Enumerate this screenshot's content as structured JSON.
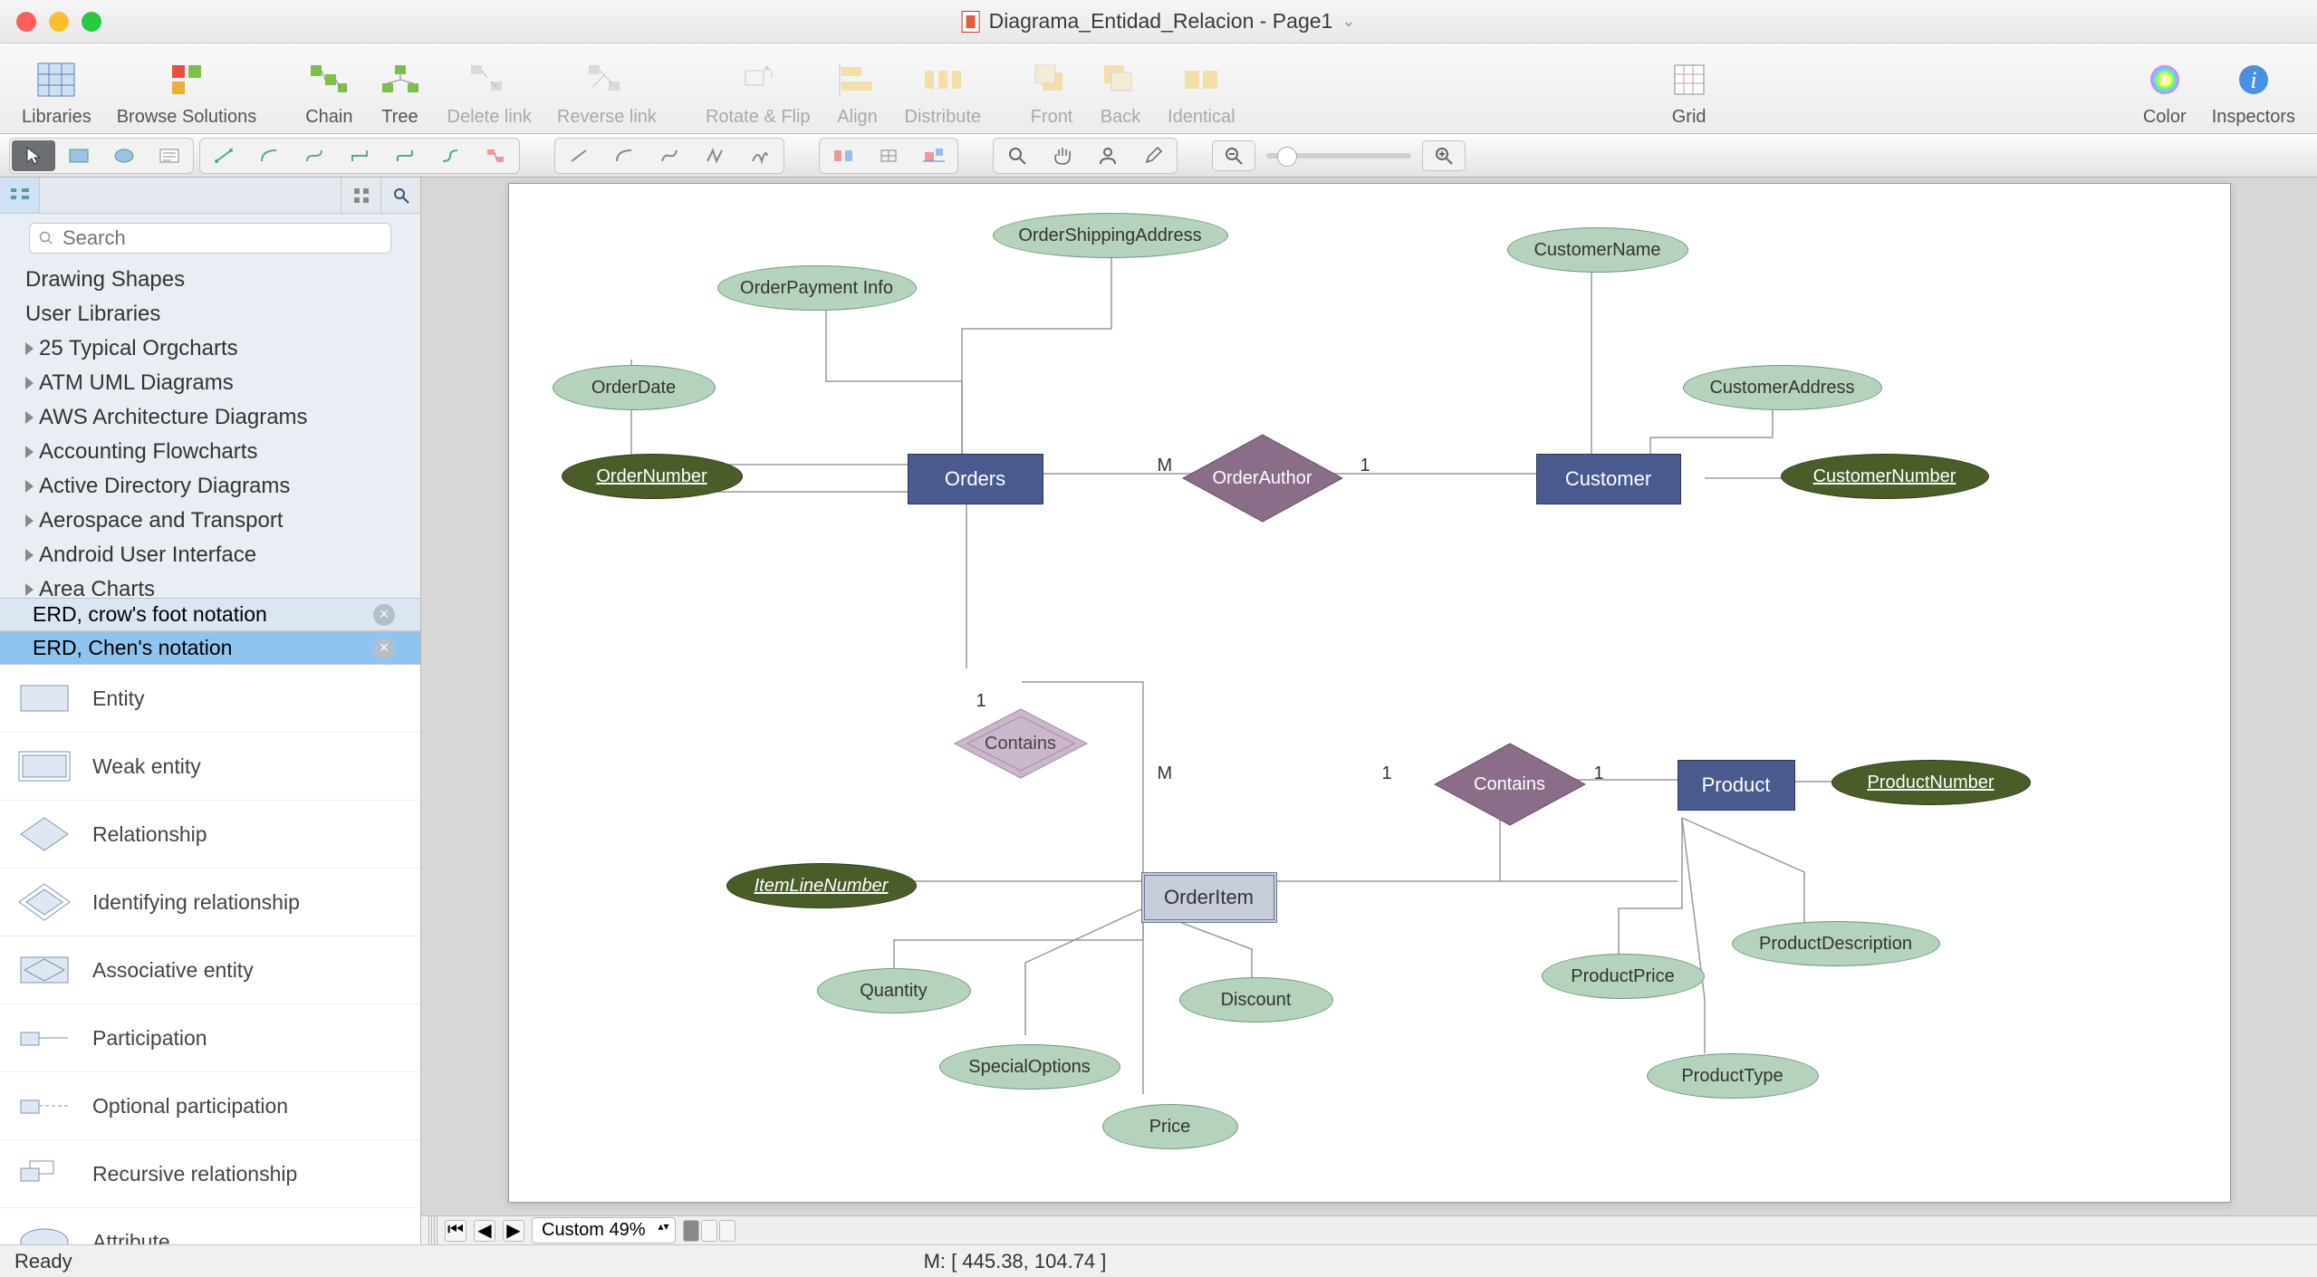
{
  "window": {
    "title": "Diagrama_Entidad_Relacion - Page1"
  },
  "toolbar": {
    "libraries": "Libraries",
    "browse": "Browse Solutions",
    "chain": "Chain",
    "tree": "Tree",
    "delete_link": "Delete link",
    "reverse_link": "Reverse link",
    "rotate_flip": "Rotate & Flip",
    "align": "Align",
    "distribute": "Distribute",
    "front": "Front",
    "back": "Back",
    "identical": "Identical",
    "grid": "Grid",
    "color": "Color",
    "inspectors": "Inspectors"
  },
  "sidebar": {
    "search_placeholder": "Search",
    "categories": [
      "Drawing Shapes",
      "User Libraries",
      "25 Typical Orgcharts",
      "ATM UML Diagrams",
      "AWS Architecture Diagrams",
      "Accounting Flowcharts",
      "Active Directory Diagrams",
      "Aerospace and Transport",
      "Android User Interface",
      "Area Charts"
    ],
    "open_libs": {
      "crowfoot": "ERD, crow's foot notation",
      "chen": "ERD, Chen's notation"
    },
    "stencils": [
      "Entity",
      "Weak entity",
      "Relationship",
      "Identifying relationship",
      "Associative entity",
      "Participation",
      "Optional participation",
      "Recursive relationship",
      "Attribute"
    ]
  },
  "diagram": {
    "entities": {
      "orders": "Orders",
      "customer": "Customer",
      "product": "Product",
      "orderitem": "OrderItem"
    },
    "relationships": {
      "order_author": "OrderAuthor",
      "contains1": "Contains",
      "contains2": "Contains"
    },
    "attributes": {
      "order_date": "OrderDate",
      "order_payment": "OrderPayment Info",
      "order_shipping": "OrderShippingAddress",
      "order_number": "OrderNumber",
      "customer_name": "CustomerName",
      "customer_address": "CustomerAddress",
      "customer_number": "CustomerNumber",
      "item_line_number": "ItemLineNumber",
      "quantity": "Quantity",
      "special_options": "SpecialOptions",
      "price": "Price",
      "discount": "Discount",
      "product_number": "ProductNumber",
      "product_price": "ProductPrice",
      "product_description": "ProductDescription",
      "product_type": "ProductType"
    },
    "cardinalities": {
      "m": "M",
      "one": "1"
    }
  },
  "footer": {
    "zoom": "Custom 49%",
    "status": "Ready",
    "mouse": "M: [ 445.38, 104.74 ]"
  }
}
